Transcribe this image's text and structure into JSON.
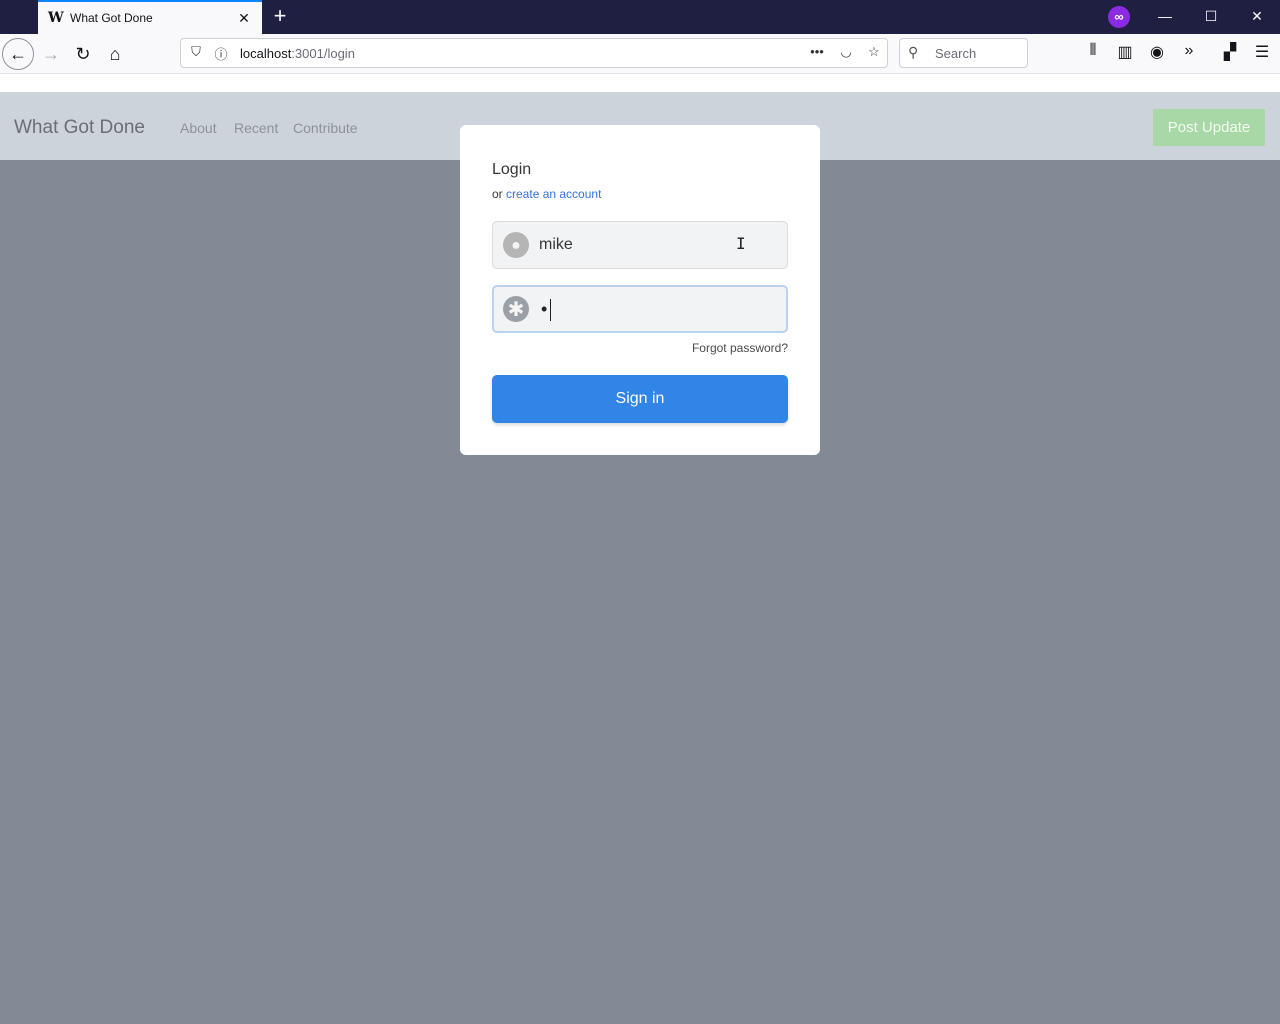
{
  "browser": {
    "tab_title": "What Got Done",
    "tab_favicon": "W",
    "url_host": "localhost",
    "url_rest": ":3001/login",
    "search_placeholder": "Search",
    "icons": {
      "back": "back-arrow-icon",
      "forward": "forward-arrow-icon",
      "reload": "reload-icon",
      "home": "home-icon",
      "shield": "shield-icon",
      "info": "info-icon",
      "more": "more-icon",
      "pocket": "pocket-icon",
      "bookmark": "star-icon",
      "library": "library-icon",
      "sidebar": "sidebar-icon",
      "account": "account-icon",
      "overflow": "chevron-double-right-icon",
      "extensions": "extensions-icon",
      "menu": "hamburger-menu-icon",
      "private": "private-browsing-icon"
    }
  },
  "header": {
    "brand": "What Got Done",
    "nav": [
      "About",
      "Recent",
      "Contribute"
    ],
    "post_update": "Post Update",
    "post_update_color": "#a8d8a5"
  },
  "login": {
    "title": "Login",
    "or_text": "or",
    "create_account": "create an account",
    "username_value": "mike",
    "password_mask": "•",
    "forgot_password": "Forgot password?",
    "signin": "Sign in",
    "signin_color": "#3185e6",
    "link_color": "#3273dc"
  }
}
